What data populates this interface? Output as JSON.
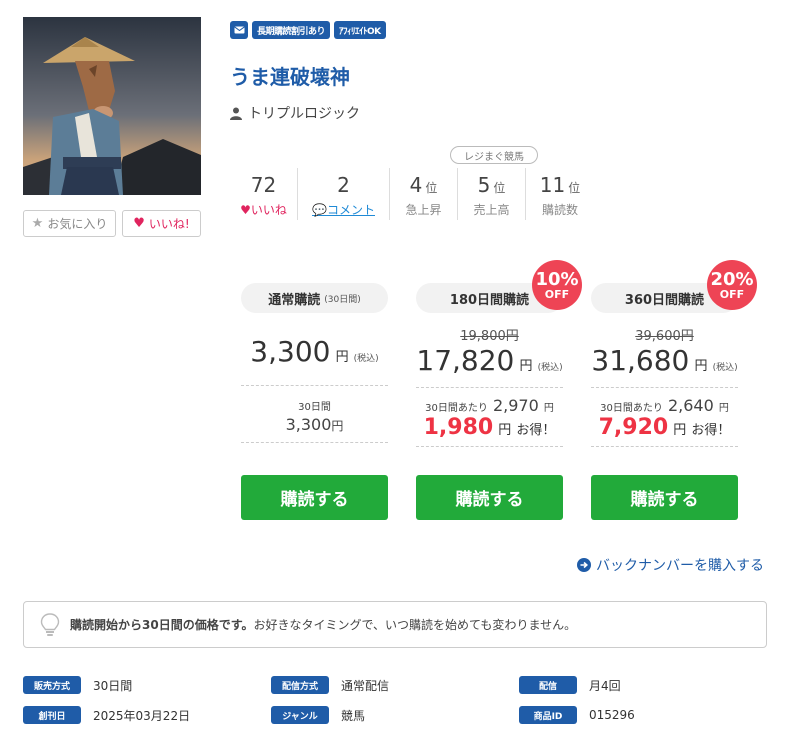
{
  "badges": {
    "tag1": "長期購読割引あり",
    "tag2": "ｱﾌｨﾘｴｲﾄOK"
  },
  "title": "うま連破壊神",
  "author": "トリプルロジック",
  "buttons": {
    "favorite": "お気に入り",
    "like": "いいね!"
  },
  "stats": {
    "likes": {
      "value": "72",
      "label": "いいね"
    },
    "comments": {
      "value": "2",
      "label": "コメント"
    },
    "rank_tag": "レジまぐ競馬",
    "rank_unit": "位",
    "rising": {
      "value": "4",
      "label": "急上昇"
    },
    "sales": {
      "value": "5",
      "label": "売上高"
    },
    "subscribers": {
      "value": "11",
      "label": "購読数"
    }
  },
  "plans": [
    {
      "name": "通常購読",
      "sub": "(30日間)",
      "original": "",
      "price": "3,300",
      "per_label": "30日間",
      "per_price": "3,300",
      "saving": "",
      "off": ""
    },
    {
      "name": "180日間購読",
      "sub": "",
      "original": "19,800円",
      "price": "17,820",
      "per_label": "30日間あたり",
      "per_price": "2,970",
      "saving": "1,980",
      "off": "10%"
    },
    {
      "name": "360日間購読",
      "sub": "",
      "original": "39,600円",
      "price": "31,680",
      "per_label": "30日間あたり",
      "per_price": "2,640",
      "saving": "7,920",
      "off": "20%"
    }
  ],
  "labels": {
    "yen": "円",
    "tax": "(税込)",
    "otoku": "お得！",
    "off": "OFF",
    "buy": "購読する"
  },
  "backnumber": "バックナンバーを購入する",
  "notice": {
    "bold": "購読開始から30日間の価格です。",
    "text": "お好きなタイミングで、いつ購読を始めても変わりません。"
  },
  "info": [
    {
      "key": "販売方式",
      "value": "30日間"
    },
    {
      "key": "配信方式",
      "value": "通常配信"
    },
    {
      "key": "配信",
      "value": "月4回"
    },
    {
      "key": "創刊日",
      "value": "2025年03月22日"
    },
    {
      "key": "ジャンル",
      "value": "競馬"
    },
    {
      "key": "商品ID",
      "value": "015296"
    }
  ],
  "colors": {
    "brand": "#1f5ca8",
    "buy": "#22aa3a",
    "sale": "#ee4455",
    "like": "#e0245e"
  }
}
